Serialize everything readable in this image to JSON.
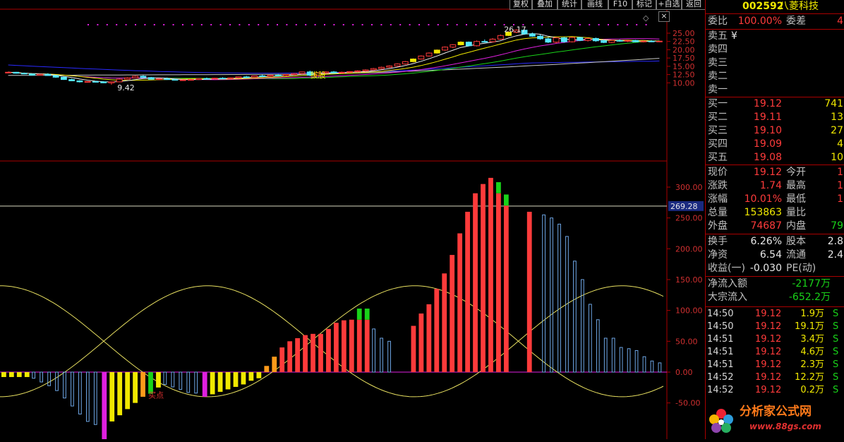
{
  "toolbar": {
    "buttons": [
      "复权",
      "叠加",
      "统计",
      "画线",
      "F10",
      "标记",
      "+自选",
      "返回"
    ]
  },
  "window": {
    "close_glyph": "×"
  },
  "price_chart": {
    "axis_ticks": [
      "25.00",
      "22.50",
      "20.00",
      "17.50",
      "15.00",
      "12.50",
      "10.00"
    ],
    "tick_values": [
      25,
      22.5,
      20,
      17.5,
      15,
      12.5,
      10
    ],
    "high_label": "26.17",
    "low_label": "9.42",
    "marker_text": "拔股",
    "high_value": 26.17,
    "low_value": 9.42,
    "candles": [
      [
        13.1,
        13.4,
        12.9,
        13.2
      ],
      [
        13.2,
        13.3,
        12.8,
        12.9
      ],
      [
        12.9,
        13.1,
        12.6,
        12.7
      ],
      [
        12.7,
        12.8,
        12.2,
        12.3
      ],
      [
        12.3,
        12.7,
        12.2,
        12.6
      ],
      [
        12.6,
        12.9,
        12.1,
        12.2
      ],
      [
        12.2,
        12.3,
        11.5,
        11.7
      ],
      [
        11.7,
        11.9,
        10.9,
        11.0
      ],
      [
        11.0,
        11.3,
        10.5,
        10.6
      ],
      [
        10.6,
        10.8,
        10.1,
        10.3
      ],
      [
        10.3,
        10.5,
        10.1,
        10.4
      ],
      [
        10.4,
        10.6,
        10.2,
        10.3
      ],
      [
        10.3,
        10.5,
        9.9,
        10.0
      ],
      [
        10.0,
        10.4,
        9.42,
        10.3
      ],
      [
        10.3,
        11.3,
        10.2,
        11.1
      ],
      [
        11.1,
        11.7,
        11.0,
        11.5
      ],
      [
        11.5,
        12.2,
        11.4,
        12.0
      ],
      [
        12.0,
        12.3,
        11.5,
        11.6
      ],
      [
        11.6,
        11.8,
        11.0,
        11.1
      ],
      [
        11.1,
        11.4,
        10.8,
        11.2
      ],
      [
        11.2,
        11.6,
        10.9,
        11.0
      ],
      [
        11.0,
        11.3,
        10.7,
        10.8
      ],
      [
        10.8,
        11.0,
        10.6,
        10.9
      ],
      [
        10.9,
        11.2,
        10.7,
        11.0
      ],
      [
        11.0,
        11.4,
        10.9,
        11.3
      ],
      [
        11.3,
        11.6,
        11.1,
        11.2
      ],
      [
        11.2,
        11.5,
        11.0,
        11.4
      ],
      [
        11.4,
        11.7,
        11.2,
        11.3
      ],
      [
        11.3,
        11.6,
        11.1,
        11.5
      ],
      [
        11.5,
        11.9,
        11.3,
        11.8
      ],
      [
        11.8,
        12.1,
        11.6,
        11.7
      ],
      [
        11.7,
        12.2,
        11.6,
        12.1
      ],
      [
        12.1,
        12.5,
        11.9,
        12.0
      ],
      [
        12.0,
        12.4,
        11.8,
        12.3
      ],
      [
        12.3,
        12.7,
        12.1,
        12.2
      ],
      [
        12.2,
        12.6,
        12.0,
        12.5
      ],
      [
        12.5,
        13.0,
        12.3,
        12.8
      ],
      [
        12.8,
        13.4,
        12.6,
        13.3
      ],
      [
        13.3,
        13.7,
        12.0,
        12.3
      ],
      [
        12.3,
        13.2,
        12.1,
        13.0
      ],
      [
        13.0,
        13.5,
        12.8,
        13.3
      ],
      [
        13.3,
        13.6,
        12.9,
        13.0
      ],
      [
        13.0,
        13.4,
        12.8,
        13.2
      ],
      [
        13.2,
        13.5,
        13.0,
        13.4
      ],
      [
        13.4,
        13.8,
        13.2,
        13.6
      ],
      [
        13.6,
        14.1,
        13.4,
        13.9
      ],
      [
        13.9,
        14.5,
        13.7,
        14.3
      ],
      [
        14.3,
        14.9,
        14.1,
        14.7
      ],
      [
        14.7,
        15.3,
        14.5,
        15.1
      ],
      [
        15.1,
        15.9,
        14.9,
        15.7
      ],
      [
        15.7,
        16.6,
        15.5,
        16.4
      ],
      [
        16.4,
        17.4,
        16.2,
        17.2
      ],
      [
        17.2,
        18.3,
        17.0,
        18.1
      ],
      [
        18.1,
        19.2,
        17.9,
        19.0
      ],
      [
        19.0,
        20.1,
        18.8,
        19.9
      ],
      [
        19.9,
        21.0,
        19.7,
        20.8
      ],
      [
        20.8,
        21.7,
        20.5,
        21.5
      ],
      [
        21.5,
        22.6,
        21.3,
        22.3
      ],
      [
        22.3,
        22.5,
        21.0,
        21.2
      ],
      [
        21.2,
        22.8,
        21.0,
        22.5
      ],
      [
        22.5,
        23.1,
        22.2,
        22.4
      ],
      [
        22.4,
        23.5,
        22.2,
        23.2
      ],
      [
        23.2,
        24.6,
        23.0,
        24.3
      ],
      [
        24.3,
        25.6,
        24.1,
        25.3
      ],
      [
        25.3,
        26.17,
        25.0,
        25.9
      ],
      [
        25.9,
        26.0,
        24.5,
        24.8
      ],
      [
        24.8,
        25.2,
        23.9,
        24.1
      ],
      [
        24.1,
        24.6,
        23.0,
        23.3
      ],
      [
        23.3,
        23.8,
        22.0,
        22.3
      ],
      [
        22.3,
        23.8,
        21.9,
        23.6
      ],
      [
        23.6,
        23.9,
        22.1,
        22.4
      ],
      [
        22.4,
        23.9,
        22.2,
        23.7
      ],
      [
        23.7,
        23.9,
        22.6,
        22.8
      ],
      [
        22.8,
        23.6,
        22.5,
        23.4
      ],
      [
        23.4,
        23.7,
        22.4,
        22.7
      ],
      [
        22.7,
        23.0,
        22.0,
        22.2
      ],
      [
        22.2,
        23.0,
        22.0,
        22.8
      ],
      [
        22.8,
        23.1,
        22.4,
        22.6
      ],
      [
        22.6,
        22.9,
        22.3,
        22.8
      ],
      [
        22.8,
        23.0,
        22.3,
        22.4
      ],
      [
        22.4,
        22.8,
        22.2,
        22.6
      ],
      [
        22.6,
        22.9,
        22.4,
        22.5
      ],
      [
        22.5,
        22.7,
        22.3,
        22.6
      ]
    ]
  },
  "indicator": {
    "axis_ticks": [
      "300.00",
      "250.00",
      "200.00",
      "150.00",
      "100.00",
      "50.00",
      "0.00",
      "-50.00"
    ],
    "tick_values": [
      300,
      250,
      200,
      150,
      100,
      50,
      0,
      -50
    ],
    "level_value": 269.28,
    "level_label": "269.28",
    "buy_text": "买点",
    "bars": [
      [
        -8,
        "Y"
      ],
      [
        -8,
        "Y"
      ],
      [
        -8,
        "Y"
      ],
      [
        -8,
        "Y"
      ],
      [
        -10,
        "B"
      ],
      [
        -16,
        "B"
      ],
      [
        -22,
        "B"
      ],
      [
        -30,
        "B"
      ],
      [
        -42,
        "B"
      ],
      [
        -55,
        "B"
      ],
      [
        -68,
        "B"
      ],
      [
        -80,
        "B"
      ],
      [
        -85,
        "B"
      ],
      [
        -112,
        "M"
      ],
      [
        -80,
        "Y"
      ],
      [
        -70,
        "Y"
      ],
      [
        -60,
        "Y"
      ],
      [
        -50,
        "Y"
      ],
      [
        -40,
        "O"
      ],
      [
        -35,
        "G"
      ],
      [
        -25,
        "Y"
      ],
      [
        -20,
        "B"
      ],
      [
        -24,
        "B"
      ],
      [
        -28,
        "B"
      ],
      [
        -33,
        "B"
      ],
      [
        -34,
        "B"
      ],
      [
        -40,
        "M"
      ],
      [
        -36,
        "Y"
      ],
      [
        -32,
        "Y"
      ],
      [
        -28,
        "Y"
      ],
      [
        -24,
        "Y"
      ],
      [
        -20,
        "Y"
      ],
      [
        -14,
        "Y"
      ],
      [
        -10,
        "Y"
      ],
      [
        10,
        "O"
      ],
      [
        25,
        "O"
      ],
      [
        40,
        "R"
      ],
      [
        50,
        "R"
      ],
      [
        55,
        "R"
      ],
      [
        60,
        "R"
      ],
      [
        62,
        "R"
      ],
      [
        62,
        "R"
      ],
      [
        70,
        "R"
      ],
      [
        80,
        "R"
      ],
      [
        84,
        "R"
      ],
      [
        85,
        "R"
      ],
      [
        85,
        "RG"
      ],
      [
        85,
        "RG"
      ],
      [
        70,
        "B"
      ],
      [
        55,
        "B"
      ],
      [
        50,
        "B"
      ],
      [
        0,
        "N"
      ],
      [
        0,
        "N"
      ],
      [
        75,
        "R"
      ],
      [
        95,
        "R"
      ],
      [
        110,
        "R"
      ],
      [
        135,
        "R"
      ],
      [
        160,
        "R"
      ],
      [
        190,
        "R"
      ],
      [
        225,
        "R"
      ],
      [
        260,
        "R"
      ],
      [
        290,
        "R"
      ],
      [
        305,
        "R"
      ],
      [
        315,
        "R"
      ],
      [
        290,
        "RG"
      ],
      [
        270,
        "RG"
      ],
      [
        0,
        "N"
      ],
      [
        0,
        "N"
      ],
      [
        260,
        "R"
      ],
      [
        0,
        "N"
      ],
      [
        255,
        "B"
      ],
      [
        250,
        "B"
      ],
      [
        240,
        "B"
      ],
      [
        220,
        "B"
      ],
      [
        180,
        "B"
      ],
      [
        150,
        "B"
      ],
      [
        110,
        "B"
      ],
      [
        85,
        "B"
      ],
      [
        55,
        "B"
      ],
      [
        55,
        "B"
      ],
      [
        40,
        "B"
      ],
      [
        38,
        "B"
      ],
      [
        35,
        "B"
      ],
      [
        25,
        "B"
      ],
      [
        18,
        "B"
      ],
      [
        15,
        "B"
      ]
    ]
  },
  "quote": {
    "code": "002592",
    "name": "八菱科技",
    "weibi_label": "委比",
    "weibi": "100.00%",
    "weicha_label": "委差",
    "weicha": "4",
    "asks": [
      {
        "label": "卖五",
        "price": "¥",
        "vol": ""
      },
      {
        "label": "卖四",
        "price": "",
        "vol": ""
      },
      {
        "label": "卖三",
        "price": "",
        "vol": ""
      },
      {
        "label": "卖二",
        "price": "",
        "vol": ""
      },
      {
        "label": "卖一",
        "price": "",
        "vol": ""
      }
    ],
    "bids": [
      {
        "label": "买一",
        "price": "19.12",
        "vol": "741"
      },
      {
        "label": "买二",
        "price": "19.11",
        "vol": "13"
      },
      {
        "label": "买三",
        "price": "19.10",
        "vol": "27"
      },
      {
        "label": "买四",
        "price": "19.09",
        "vol": "4"
      },
      {
        "label": "买五",
        "price": "19.08",
        "vol": "10"
      }
    ],
    "stats1": [
      {
        "l1": "现价",
        "v1": "19.12",
        "c1": "red",
        "l2": "今开",
        "v2": "1",
        "c2": "red"
      },
      {
        "l1": "涨跌",
        "v1": "1.74",
        "c1": "red",
        "l2": "最高",
        "v2": "1",
        "c2": "red"
      },
      {
        "l1": "涨幅",
        "v1": "10.01%",
        "c1": "red",
        "l2": "最低",
        "v2": "1",
        "c2": "red"
      },
      {
        "l1": "总量",
        "v1": "153863",
        "c1": "yellow",
        "l2": "量比",
        "v2": "",
        "c2": "white"
      },
      {
        "l1": "外盘",
        "v1": "74687",
        "c1": "red",
        "l2": "内盘",
        "v2": "79",
        "c2": "green"
      }
    ],
    "stats2": [
      {
        "l1": "换手",
        "v1": "6.26%",
        "c1": "white",
        "l2": "股本",
        "v2": "2.8",
        "c2": "white"
      },
      {
        "l1": "净资",
        "v1": "6.54",
        "c1": "white",
        "l2": "流通",
        "v2": "2.4",
        "c2": "white"
      },
      {
        "l1": "收益(一)",
        "v1": "-0.030",
        "c1": "white",
        "l2": "PE(动)",
        "v2": "",
        "c2": "white"
      }
    ],
    "flows": [
      {
        "label": "净流入额",
        "value": "-2177万"
      },
      {
        "label": "大宗流入",
        "value": "-652.2万"
      }
    ],
    "ticks": [
      {
        "time": "14:50",
        "price": "19.12",
        "vol": "1.9万",
        "flag": "S"
      },
      {
        "time": "14:50",
        "price": "19.12",
        "vol": "19.1万",
        "flag": "S"
      },
      {
        "time": "14:51",
        "price": "19.12",
        "vol": "3.4万",
        "flag": "S"
      },
      {
        "time": "14:51",
        "price": "19.12",
        "vol": "4.6万",
        "flag": "S"
      },
      {
        "time": "14:51",
        "price": "19.12",
        "vol": "2.3万",
        "flag": "S"
      },
      {
        "time": "14:52",
        "price": "19.12",
        "vol": "12.2万",
        "flag": "S"
      },
      {
        "time": "14:52",
        "price": "19.12",
        "vol": "0.2万",
        "flag": "S"
      }
    ]
  },
  "watermark": {
    "title": "分析家公式网",
    "url": "www.88gs.com"
  },
  "colors": {
    "up": "#ff3b3b",
    "down": "#54e8ff",
    "blue_bar": "#6fa8e8",
    "yellow": "#f0e800",
    "orange": "#ff9a1a",
    "magenta": "#e020e0",
    "green": "#19d219"
  }
}
